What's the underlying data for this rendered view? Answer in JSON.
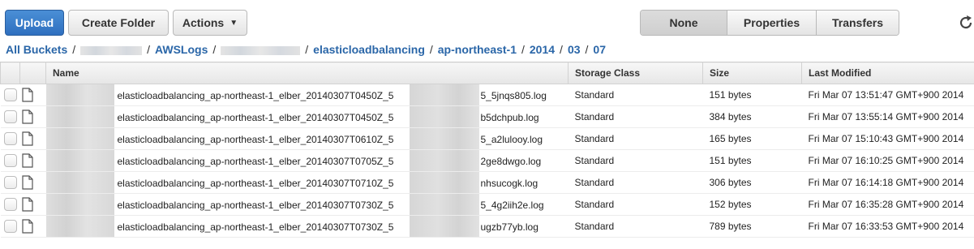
{
  "toolbar": {
    "upload_label": "Upload",
    "create_folder_label": "Create Folder",
    "actions_label": "Actions",
    "view_modes": [
      "None",
      "Properties",
      "Transfers"
    ],
    "accent_color": "#3a7fcf"
  },
  "breadcrumb": {
    "items": [
      "All Buckets",
      "AWSLogs",
      "elasticloadbalancing",
      "ap-northeast-1",
      "2014",
      "03",
      "07"
    ]
  },
  "table": {
    "columns": [
      "Name",
      "Storage Class",
      "Size",
      "Last Modified"
    ],
    "rows": [
      {
        "name_start": "elasticloadbalancing_ap-northeast-1_elber_20140307T0450Z_5",
        "name_end": "5_5jnqs805.log",
        "storage": "Standard",
        "size": "151 bytes",
        "modified": "Fri Mar 07 13:51:47 GMT+900 2014"
      },
      {
        "name_start": "elasticloadbalancing_ap-northeast-1_elber_20140307T0450Z_5",
        "name_end": "b5dchpub.log",
        "storage": "Standard",
        "size": "384 bytes",
        "modified": "Fri Mar 07 13:55:14 GMT+900 2014"
      },
      {
        "name_start": "elasticloadbalancing_ap-northeast-1_elber_20140307T0610Z_5",
        "name_end": "5_a2lulooy.log",
        "storage": "Standard",
        "size": "165 bytes",
        "modified": "Fri Mar 07 15:10:43 GMT+900 2014"
      },
      {
        "name_start": "elasticloadbalancing_ap-northeast-1_elber_20140307T0705Z_5",
        "name_end": "2ge8dwgo.log",
        "storage": "Standard",
        "size": "151 bytes",
        "modified": "Fri Mar 07 16:10:25 GMT+900 2014"
      },
      {
        "name_start": "elasticloadbalancing_ap-northeast-1_elber_20140307T0710Z_5",
        "name_end": "nhsucogk.log",
        "storage": "Standard",
        "size": "306 bytes",
        "modified": "Fri Mar 07 16:14:18 GMT+900 2014"
      },
      {
        "name_start": "elasticloadbalancing_ap-northeast-1_elber_20140307T0730Z_5",
        "name_end": "5_4g2iih2e.log",
        "storage": "Standard",
        "size": "152 bytes",
        "modified": "Fri Mar 07 16:35:28 GMT+900 2014"
      },
      {
        "name_start": "elasticloadbalancing_ap-northeast-1_elber_20140307T0730Z_5",
        "name_end": "ugzb77yb.log",
        "storage": "Standard",
        "size": "789 bytes",
        "modified": "Fri Mar 07 16:33:53 GMT+900 2014"
      }
    ]
  }
}
